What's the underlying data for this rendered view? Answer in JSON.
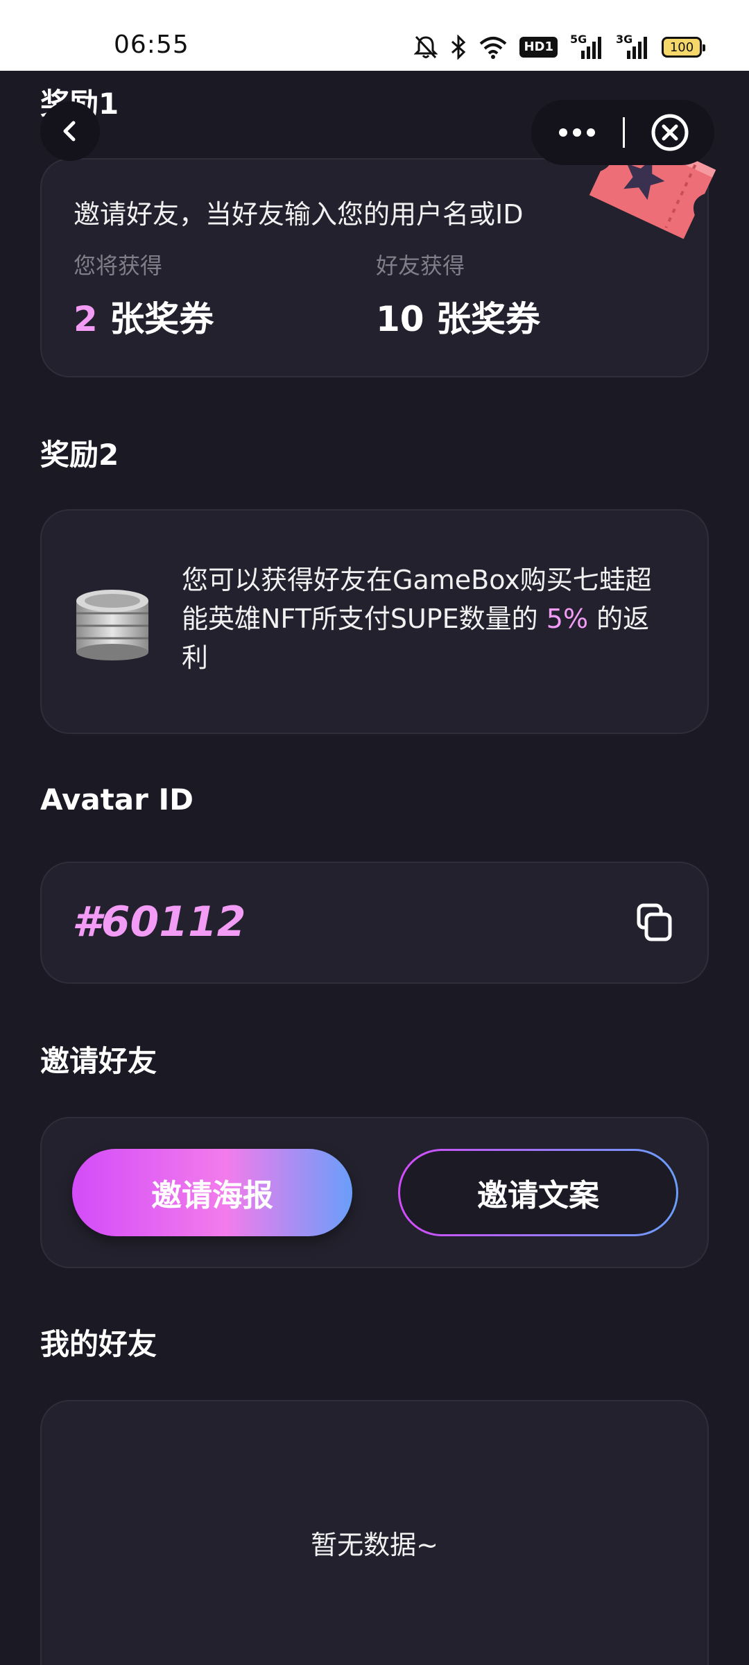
{
  "status_bar": {
    "time": "06:55",
    "hd_label": "HD1",
    "net1_label": "5G",
    "net2_label": "3G",
    "battery": "100"
  },
  "nav": {
    "back_icon": "chevron-left-icon",
    "more_icon": "more-dots-icon",
    "close_icon": "close-circle-icon"
  },
  "reward1": {
    "title": "奖励1",
    "description": "邀请好友，当好友输入您的用户名或ID",
    "you_get_label": "您将获得",
    "you_get_count": "2",
    "you_get_unit": " 张奖券",
    "friend_get_label": "好友获得",
    "friend_get_value": "10 张奖券"
  },
  "reward2": {
    "title": "奖励2",
    "text_before": "您可以获得好友在GameBox购买七蛙超能英雄NFT所支付SUPE数量的 ",
    "percent": "5%",
    "text_after": " 的返利"
  },
  "avatar": {
    "title": "Avatar ID",
    "id_value": "#60112",
    "copy_icon": "copy-icon"
  },
  "invite": {
    "title": "邀请好友",
    "poster_button": "邀请海报",
    "copy_button": "邀请文案"
  },
  "friends": {
    "title": "我的好友",
    "empty_text": "暂无数据~"
  },
  "colors": {
    "background": "#1a1924",
    "card": "#22212d",
    "accent_pink": "#f39cf6",
    "gradient_start": "#d34cf9",
    "gradient_end": "#6a9ef9"
  }
}
